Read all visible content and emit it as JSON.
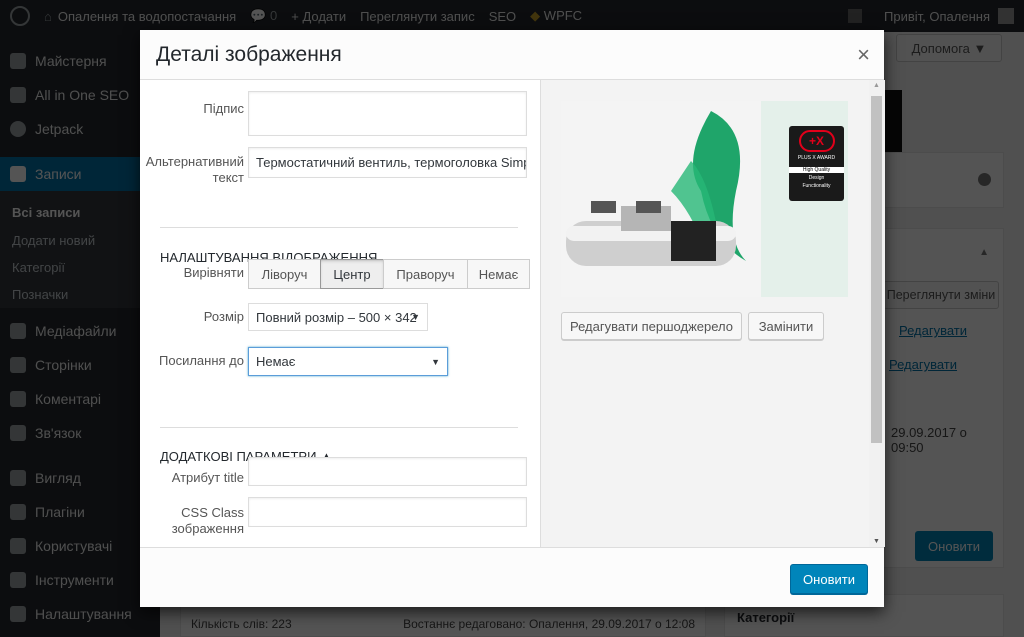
{
  "adminbar": {
    "site": "Опалення та водопостачання",
    "comments": "0",
    "add": "Додати",
    "view_post": "Переглянути запис",
    "seo": "SEO",
    "wpfc": "WPFC",
    "greeting": "Привіт, Опалення"
  },
  "sidebar": {
    "items": [
      "Майстерня",
      "All in One SEO",
      "Jetpack",
      "Записи",
      "Медіафайли",
      "Сторінки",
      "Коментарі",
      "Зв'язок",
      "Вигляд",
      "Плагіни",
      "Користувачі",
      "Інструменти",
      "Налаштування"
    ],
    "sub": [
      "Всі записи",
      "Додати новий",
      "Категорії",
      "Позначки"
    ]
  },
  "background": {
    "help": "Допомога ▼",
    "preview_changes": "Переглянути зміни",
    "edit1": "Редагувати",
    "edit2": "Редагувати",
    "date": "29.09.2017 о 09:50",
    "update": "Оновити",
    "categories": "Категорії",
    "word_count": "Кількість слів: 223",
    "last_edited": "Востаннє редаговано: Опалення, 29.09.2017 о 12:08"
  },
  "modal": {
    "title": "Деталі зображення",
    "close": "×",
    "caption_label": "Підпис",
    "caption_value": "",
    "alt_label": "Альтернативний текст",
    "alt_value": "Термостатичний вентиль, термоголовка Simple",
    "display_heading": "Налаштування відображення",
    "align_label": "Вирівняти",
    "align_options": [
      "Ліворуч",
      "Центр",
      "Праворуч",
      "Немає"
    ],
    "align_selected": "Центр",
    "size_label": "Розмір",
    "size_value": "Повний розмір – 500 × 342",
    "link_label": "Посилання до",
    "link_value": "Немає",
    "advanced_heading": "Додаткові параметри ▲",
    "title_attr_label": "Атрибут title",
    "title_attr_value": "",
    "css_class_label": "CSS Class зображення",
    "css_class_value": "",
    "edit_original": "Редагувати першоджерело",
    "replace": "Замінити",
    "update": "Оновити",
    "award": {
      "mark": "+X",
      "lines": [
        "PLUS X AWARD",
        "High Quality",
        "Design",
        "Functionality"
      ]
    }
  }
}
